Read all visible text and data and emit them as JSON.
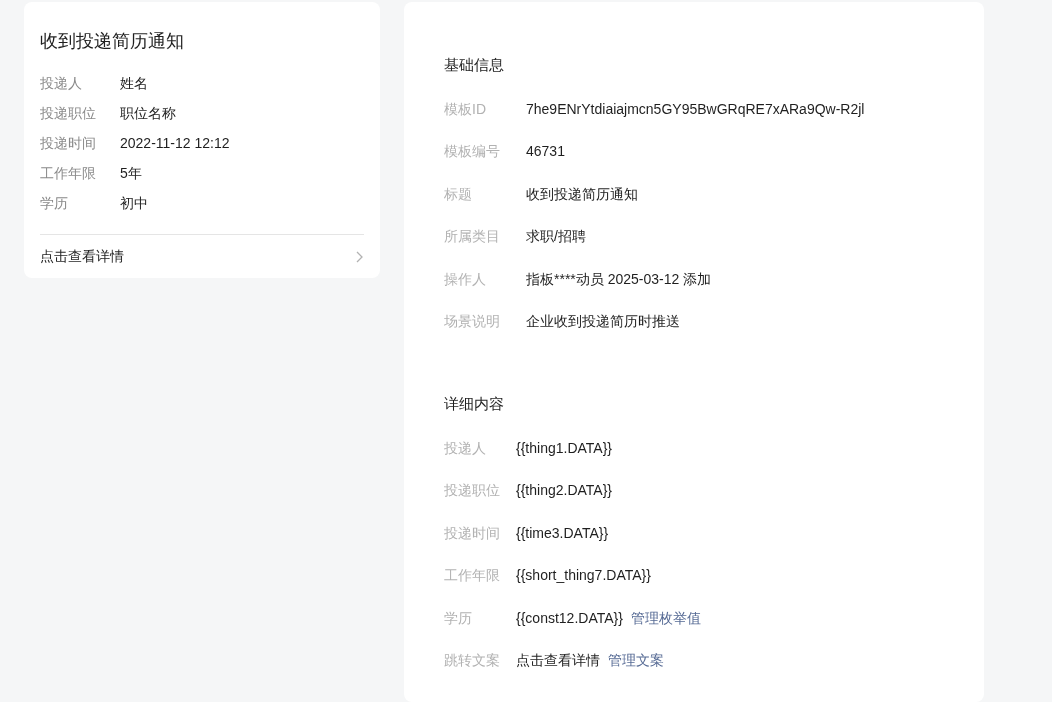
{
  "preview_card": {
    "title": "收到投递简历通知",
    "fields": [
      {
        "label": "投递人",
        "value": "姓名"
      },
      {
        "label": "投递职位",
        "value": "职位名称"
      },
      {
        "label": "投递时间",
        "value": "2022-11-12 12:12"
      },
      {
        "label": "工作年限",
        "value": "5年"
      },
      {
        "label": "学历",
        "value": "初中"
      }
    ],
    "footer_link": "点击查看详情"
  },
  "basic_info": {
    "heading": "基础信息",
    "fields": [
      {
        "label": "模板ID",
        "value": "7he9ENrYtdiaiajmcn5GY95BwGRqRE7xARa9Qw-R2jl"
      },
      {
        "label": "模板编号",
        "value": "46731"
      },
      {
        "label": "标题",
        "value": "收到投递简历通知"
      },
      {
        "label": "所属类目",
        "value": "求职/招聘"
      },
      {
        "label": "操作人",
        "value": "指板****动员 2025-03-12 添加"
      },
      {
        "label": "场景说明",
        "value": "企业收到投递简历时推送"
      }
    ]
  },
  "detail_content": {
    "heading": "详细内容",
    "fields": [
      {
        "label": "投递人",
        "value": "{{thing1.DATA}}"
      },
      {
        "label": "投递职位",
        "value": "{{thing2.DATA}}"
      },
      {
        "label": "投递时间",
        "value": "{{time3.DATA}}"
      },
      {
        "label": "工作年限",
        "value": "{{short_thing7.DATA}}"
      },
      {
        "label": "学历",
        "value": "{{const12.DATA}}",
        "link": "管理枚举值"
      },
      {
        "label": "跳转文案",
        "value": "点击查看详情",
        "link": "管理文案"
      }
    ]
  }
}
